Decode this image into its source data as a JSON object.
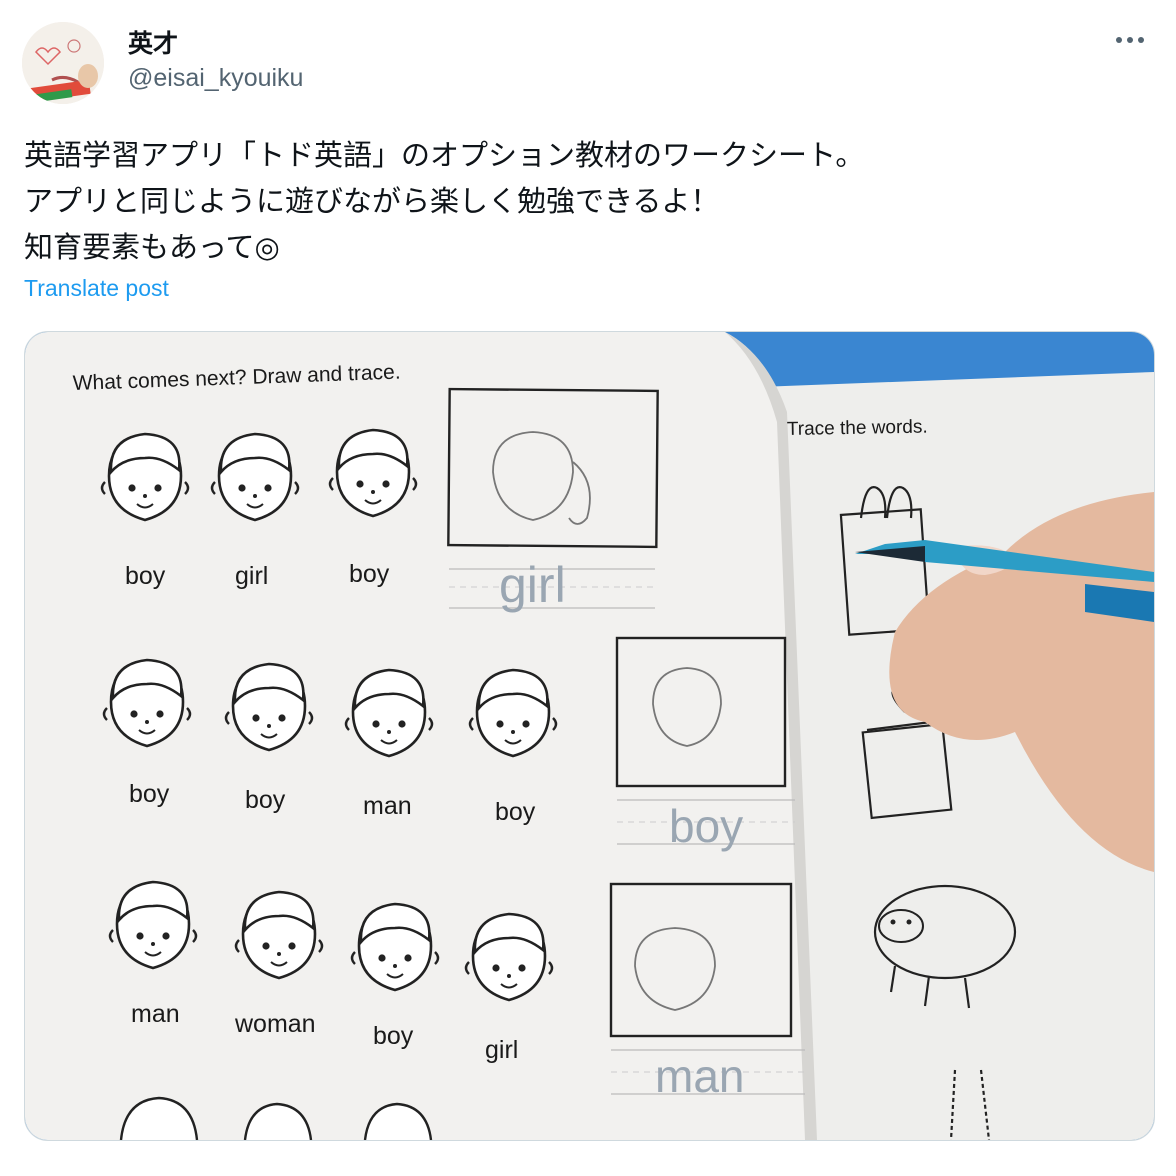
{
  "author": {
    "name": "英才",
    "handle": "@eisai_kyouiku"
  },
  "post": {
    "text": "英語学習アプリ「トド英語」のオプション教材のワークシート。\nアプリと同じように遊びながら楽しく勉強できるよ！\n知育要素もあって◎",
    "translate_label": "Translate post"
  },
  "worksheet": {
    "left_title": "What comes next? Draw and trace.",
    "right_title": "Trace the words.",
    "row1": [
      "boy",
      "girl",
      "boy"
    ],
    "row2": [
      "boy",
      "boy",
      "man",
      "boy"
    ],
    "row3": [
      "man",
      "woman",
      "boy",
      "girl"
    ],
    "traced": [
      "girl",
      "boy",
      "man"
    ]
  },
  "icons": {
    "more": "more-horizontal-icon"
  }
}
